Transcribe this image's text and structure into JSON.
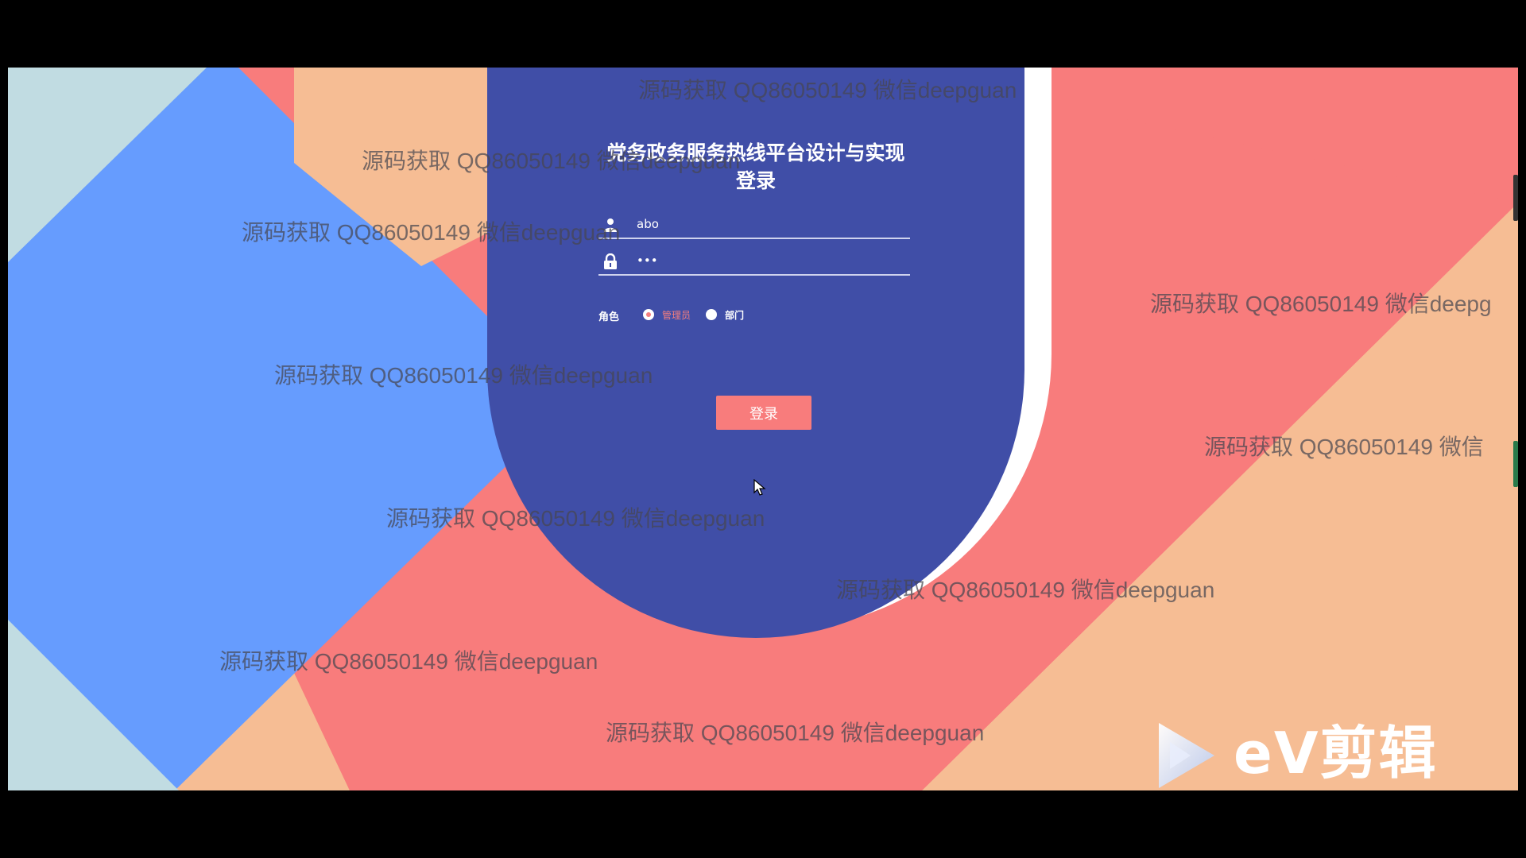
{
  "app": {
    "title": "党务政务服务热线平台设计与实现",
    "subtitle": "登录"
  },
  "form": {
    "username_value": "abo",
    "password_value": "•••",
    "role_label": "角色",
    "role_options": [
      "管理员",
      "部门"
    ],
    "role_selected": "管理员",
    "login_label": "登录"
  },
  "watermarks": {
    "text": "源码获取 QQ86050149 微信deepguan",
    "text_cut_1": "源码获取 QQ86050149 微信deepg",
    "text_cut_2": "源码获取 QQ86050149 微信"
  },
  "overlay": {
    "brand_text": "eV剪辑"
  },
  "colors": {
    "panel": "#404ea7",
    "accent_red": "#f87c7c",
    "blue": "#669cfe",
    "peach": "#f6bd94",
    "pale": "#c1dce2"
  },
  "icons": {
    "user_field": "user-icon",
    "password_field": "lock-icon",
    "brand": "play-triangle-icon"
  }
}
